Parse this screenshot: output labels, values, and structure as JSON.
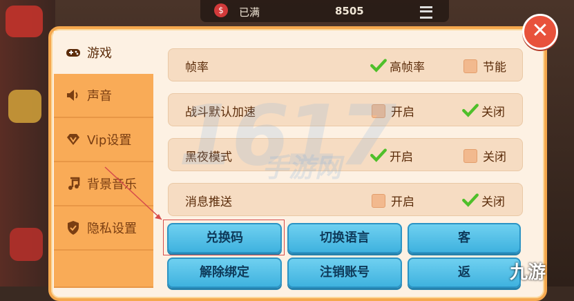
{
  "topbar": {
    "status": "已满",
    "score": "8505"
  },
  "sidebar": {
    "items": [
      {
        "label": "游戏",
        "icon": "gamepad-icon",
        "active": true
      },
      {
        "label": "声音",
        "icon": "speaker-icon",
        "active": false
      },
      {
        "label": "Vip设置",
        "icon": "diamond-icon",
        "active": false
      },
      {
        "label": "背景音乐",
        "icon": "music-note-icon",
        "active": false
      },
      {
        "label": "隐私设置",
        "icon": "shield-check-icon",
        "active": false
      }
    ]
  },
  "settings": {
    "rows": [
      {
        "label": "帧率",
        "option1": "高帧率",
        "option1_checked": true,
        "option2": "节能",
        "option2_checked": false
      },
      {
        "label": "战斗默认加速",
        "option1": "开启",
        "option1_checked": false,
        "option2": "关闭",
        "option2_checked": true
      },
      {
        "label": "黑夜模式",
        "option1": "开启",
        "option1_checked": true,
        "option2": "关闭",
        "option2_checked": false
      },
      {
        "label": "消息推送",
        "option1": "开启",
        "option1_checked": false,
        "option2": "关闭",
        "option2_checked": true
      }
    ]
  },
  "buttons": {
    "redeem": "兑换码",
    "switch_language": "切换语言",
    "service": "客",
    "unbind": "解除绑定",
    "cancel_account": "注销账号",
    "back": "返"
  },
  "watermark": {
    "main": "1617",
    "sub": "手游网",
    "corner": "九游"
  },
  "colors": {
    "panel_border": "#f5a84e",
    "button": "#3fb2df",
    "check": "#4fbf2a",
    "close": "#e8523c"
  }
}
